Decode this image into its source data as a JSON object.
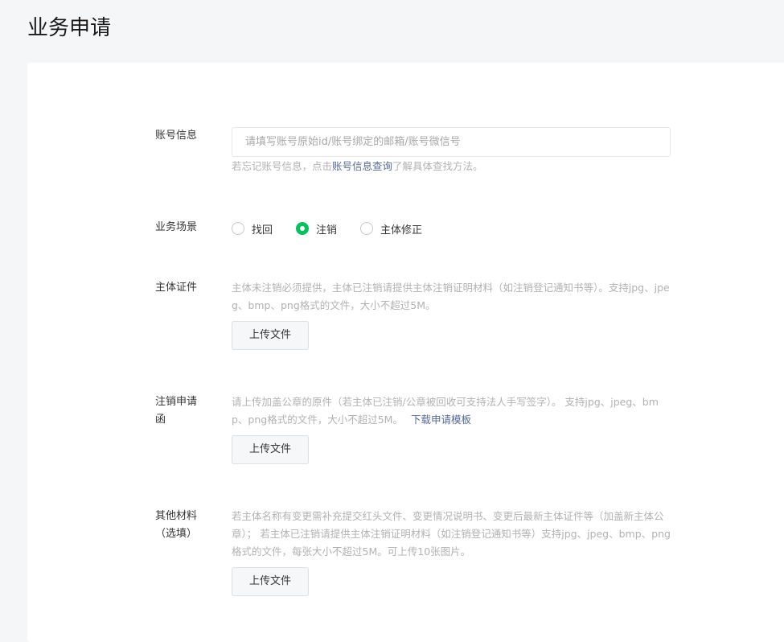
{
  "page": {
    "title": "业务申请"
  },
  "account": {
    "label": "账号信息",
    "placeholder": "请填写账号原始id/账号绑定的邮箱/账号微信号",
    "value": "",
    "tip_prefix": "若忘记账号信息，点击",
    "tip_link": "账号信息查询",
    "tip_suffix": "了解具体查找方法。"
  },
  "scene": {
    "label": "业务场景",
    "options": [
      {
        "label": "找回",
        "checked": false
      },
      {
        "label": "注销",
        "checked": true
      },
      {
        "label": "主体修正",
        "checked": false
      }
    ]
  },
  "subject_cert": {
    "label": "主体证件",
    "tip": "主体未注销必须提供，主体已注销请提供主体注销证明材料（如注销登记通知书等）。支持jpg、jpeg、bmp、png格式的文件，大小不超过5M。",
    "upload_label": "上传文件"
  },
  "cancel_letter": {
    "label": "注销申请函",
    "tip": "请上传加盖公章的原件（若主体已注销/公章被回收可支持法人手写签字）。 支持jpg、jpeg、bmp、png格式的文件，大小不超过5M。",
    "tip_link": "下载申请模板",
    "upload_label": "上传文件"
  },
  "other_materials": {
    "label": "其他材料（选填）",
    "tip": "若主体名称有变更需补充提交红头文件、变更情况说明书、变更后最新主体证件等（加盖新主体公章）； 若主体已注销请提供主体注销证明材料（如注销登记通知书等）支持jpg、jpeg、bmp、png格式的文件，每张大小不超过5M。可上传10张图片。",
    "upload_label": "上传文件"
  },
  "colors": {
    "accent_green": "#07c160",
    "link_blue": "#576b95",
    "background": "#f5f6f8"
  }
}
